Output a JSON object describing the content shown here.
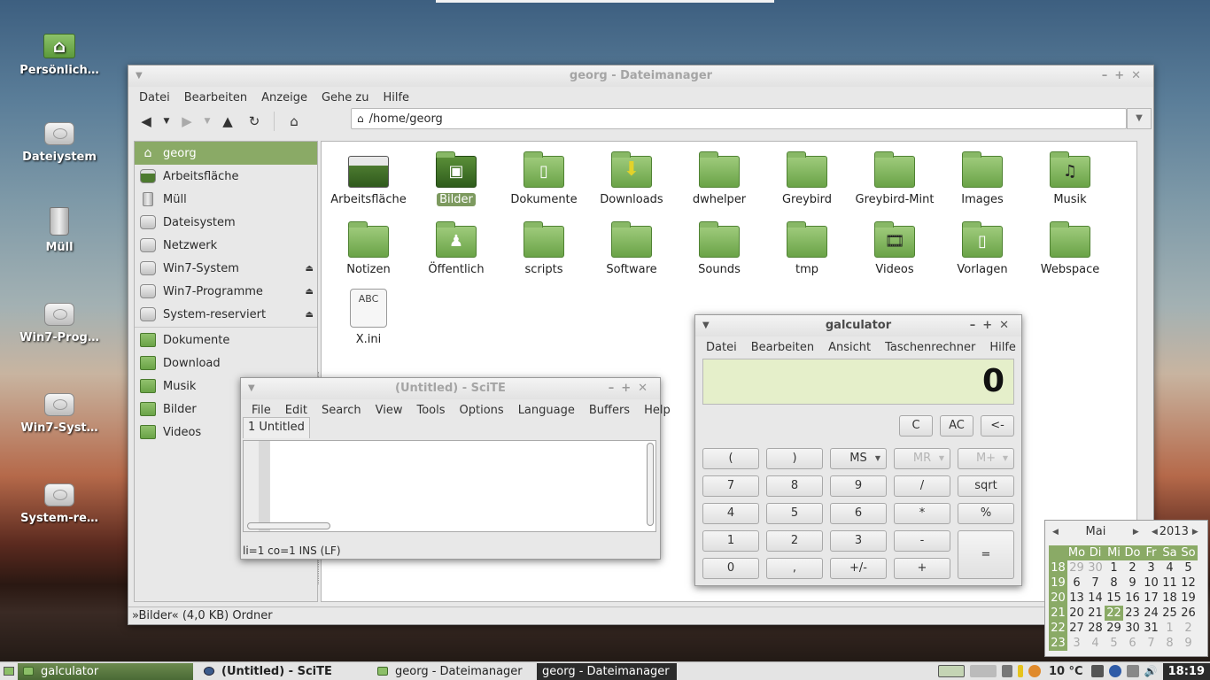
{
  "desktop": {
    "icons": [
      {
        "label": "Persönlich…"
      },
      {
        "label": "Dateiystem"
      },
      {
        "label": "Müll"
      },
      {
        "label": "Win7-Prog…"
      },
      {
        "label": "Win7-Syst…"
      },
      {
        "label": "System-re…"
      }
    ]
  },
  "filemanager": {
    "title": "georg - Dateimanager",
    "menu": [
      "Datei",
      "Bearbeiten",
      "Anzeige",
      "Gehe zu",
      "Hilfe"
    ],
    "path": "/home/georg",
    "sidebar": [
      {
        "label": "georg",
        "icon": "home-icon",
        "selected": true
      },
      {
        "label": "Arbeitsfläche",
        "icon": "desktop-icon"
      },
      {
        "label": "Müll",
        "icon": "trash-icon"
      },
      {
        "label": "Dateisystem",
        "icon": "drive-icon"
      },
      {
        "label": "Netzwerk",
        "icon": "network-icon"
      },
      {
        "label": "Win7-System",
        "icon": "drive-icon",
        "eject": true
      },
      {
        "label": "Win7-Programme",
        "icon": "drive-icon",
        "eject": true
      },
      {
        "label": "System-reserviert",
        "icon": "drive-icon",
        "eject": true
      },
      {
        "label": "Dokumente",
        "icon": "folder-icon"
      },
      {
        "label": "Download",
        "icon": "folder-icon"
      },
      {
        "label": "Musik",
        "icon": "folder-icon"
      },
      {
        "label": "Bilder",
        "icon": "folder-icon"
      },
      {
        "label": "Videos",
        "icon": "folder-icon"
      }
    ],
    "files": [
      {
        "name": "Arbeitsfläche"
      },
      {
        "name": "Bilder",
        "selected": true
      },
      {
        "name": "Dokumente"
      },
      {
        "name": "Downloads"
      },
      {
        "name": "dwhelper"
      },
      {
        "name": "Greybird"
      },
      {
        "name": "Greybird-Mint"
      },
      {
        "name": "Images"
      },
      {
        "name": "Musik"
      },
      {
        "name": "Notizen"
      },
      {
        "name": "Öffentlich"
      },
      {
        "name": "scripts"
      },
      {
        "name": "Software"
      },
      {
        "name": "Sounds"
      },
      {
        "name": "tmp"
      },
      {
        "name": "Videos"
      },
      {
        "name": "Vorlagen"
      },
      {
        "name": "Webspace"
      },
      {
        "name": "X.ini",
        "icon_text": "ABC"
      }
    ],
    "status": "»Bilder« (4,0 KB) Ordner"
  },
  "scite": {
    "title": "(Untitled) - SciTE",
    "menu": [
      "File",
      "Edit",
      "Search",
      "View",
      "Tools",
      "Options",
      "Language",
      "Buffers",
      "Help"
    ],
    "tab": "1 Untitled",
    "status": "li=1 co=1 INS (LF)"
  },
  "galculator": {
    "title": "galculator",
    "menu": [
      "Datei",
      "Bearbeiten",
      "Ansicht",
      "Taschenrechner",
      "Hilfe"
    ],
    "display": "0",
    "top_buttons": [
      "C",
      "AC",
      "<-"
    ],
    "row1": [
      "(",
      ")",
      "MS",
      "MR",
      "M+"
    ],
    "row2": [
      "7",
      "8",
      "9",
      "/",
      "sqrt"
    ],
    "row3": [
      "4",
      "5",
      "6",
      "*",
      "%"
    ],
    "row4": [
      "1",
      "2",
      "3",
      "-"
    ],
    "row5": [
      "0",
      ",",
      "+/-",
      "+"
    ],
    "equals": "="
  },
  "calendar": {
    "month": "Mai",
    "year": "2013",
    "weekdays": [
      "Mo",
      "Di",
      "Mi",
      "Do",
      "Fr",
      "Sa",
      "So"
    ],
    "weeks": [
      {
        "wk": "18",
        "days": [
          "29",
          "30",
          "1",
          "2",
          "3",
          "4",
          "5"
        ]
      },
      {
        "wk": "19",
        "days": [
          "6",
          "7",
          "8",
          "9",
          "10",
          "11",
          "12"
        ]
      },
      {
        "wk": "20",
        "days": [
          "13",
          "14",
          "15",
          "16",
          "17",
          "18",
          "19"
        ]
      },
      {
        "wk": "21",
        "days": [
          "20",
          "21",
          "22",
          "23",
          "24",
          "25",
          "26"
        ]
      },
      {
        "wk": "22",
        "days": [
          "27",
          "28",
          "29",
          "30",
          "31",
          "1",
          "2"
        ]
      },
      {
        "wk": "23",
        "days": [
          "3",
          "4",
          "5",
          "6",
          "7",
          "8",
          "9"
        ]
      }
    ],
    "today": "22"
  },
  "taskbar": {
    "tasks": [
      "galculator",
      "(Untitled) - SciTE",
      "georg - Dateimanager",
      "georg - Dateimanager"
    ],
    "temperature": "10 °C",
    "clock": "18:19"
  }
}
